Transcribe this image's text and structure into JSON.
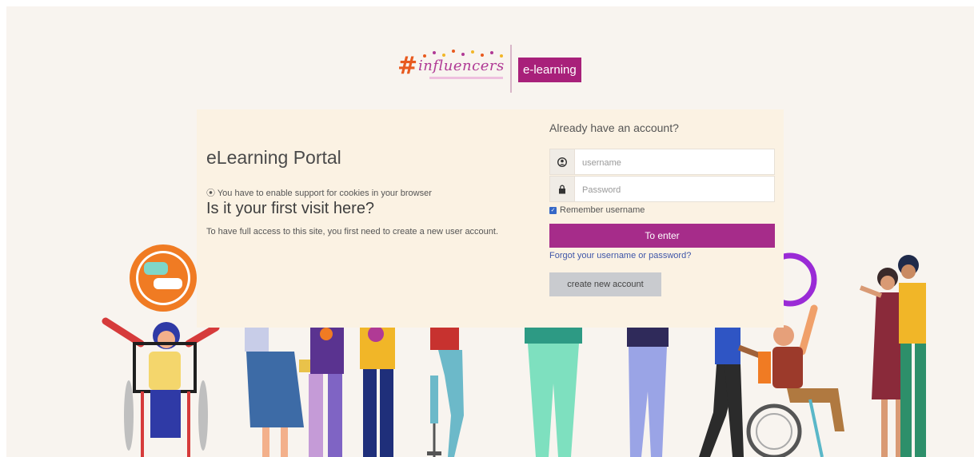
{
  "logo": {
    "brand_text": "influencers",
    "badge_text": "e-learning"
  },
  "intro": {
    "title": "eLearning Portal",
    "cookie_note": "You have to enable support for cookies in your browser",
    "first_visit_heading": "Is it your first visit here?",
    "first_visit_body": "To have full access to this site, you first need to create a new user account."
  },
  "login": {
    "heading": "Already have an account?",
    "username_placeholder": "username",
    "password_placeholder": "Password",
    "remember_label": "Remember username",
    "remember_checked": true,
    "submit_label": "To enter",
    "forgot_link": "Forgot your username or password?",
    "create_label": "create new account"
  },
  "colors": {
    "accent": "#a62c8a",
    "panel": "#fbf2e3",
    "page": "#f8f4ef",
    "link": "#3f56a8"
  }
}
